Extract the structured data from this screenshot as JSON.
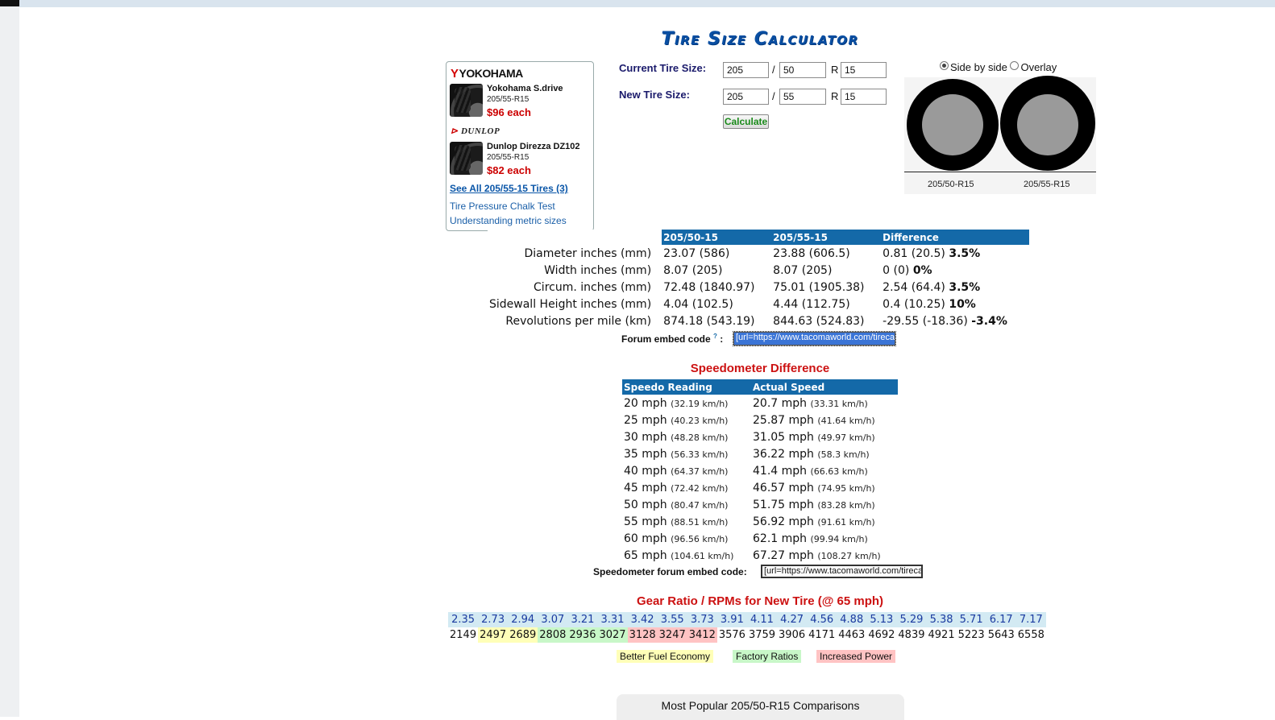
{
  "page": {
    "title": "Tire Size Calculator"
  },
  "ad": {
    "yokohama_brand": "YOKOHAMA",
    "dunlop_brand": "DUNLOP",
    "products": [
      {
        "name": "Yokohama S.drive",
        "size": "205/55-R15",
        "price": "$96 each"
      },
      {
        "name": "Dunlop Direzza DZ102",
        "size": "205/55-R15",
        "price": "$82 each"
      }
    ],
    "see_all": "See All 205/55-15 Tires (3)",
    "links": [
      "Tire Pressure Chalk Test",
      "Understanding metric sizes"
    ]
  },
  "form": {
    "current_label": "Current Tire Size:",
    "new_label": "New Tire Size:",
    "current": {
      "width": "205",
      "aspect": "50",
      "rim": "15"
    },
    "new": {
      "width": "205",
      "aspect": "55",
      "rim": "15"
    },
    "slash": "/",
    "r": "R",
    "calculate_label": "Calculate"
  },
  "visual": {
    "options": [
      "Side by side",
      "Overlay"
    ],
    "selected": "Side by side",
    "tire1_label": "205/50-R15",
    "tire2_label": "205/55-R15"
  },
  "stats": {
    "headers": [
      "205/50-15",
      "205/55-15",
      "Difference"
    ],
    "rows": [
      {
        "label": "Diameter inches (mm)",
        "a": "23.07 (586)",
        "b": "23.88 (606.5)",
        "diff": "0.81 (20.5)",
        "pct": "3.5%"
      },
      {
        "label": "Width inches (mm)",
        "a": "8.07 (205)",
        "b": "8.07 (205)",
        "diff": "0 (0)",
        "pct": "0%"
      },
      {
        "label": "Circum. inches (mm)",
        "a": "72.48 (1840.97)",
        "b": "75.01 (1905.38)",
        "diff": "2.54 (64.4)",
        "pct": "3.5%"
      },
      {
        "label": "Sidewall Height inches (mm)",
        "a": "4.04 (102.5)",
        "b": "4.44 (112.75)",
        "diff": "0.4 (10.25)",
        "pct": "10%"
      },
      {
        "label": "Revolutions per mile (km)",
        "a": "874.18 (543.19)",
        "b": "844.63 (524.83)",
        "diff": "-29.55 (-18.36)",
        "pct": "-3.4%"
      }
    ],
    "embed_label": "Forum embed code",
    "embed_help": "?",
    "embed_colon": ":",
    "embed_value": "[url=https://www.tacomaworld.com/tirecalc"
  },
  "speedo": {
    "title": "Speedometer Difference",
    "headers": [
      "Speedo Reading",
      "Actual Speed"
    ],
    "rows": [
      {
        "reading": "20 mph",
        "reading_kmh": "(32.19 km/h)",
        "actual": "20.7 mph",
        "actual_kmh": "(33.31 km/h)"
      },
      {
        "reading": "25 mph",
        "reading_kmh": "(40.23 km/h)",
        "actual": "25.87 mph",
        "actual_kmh": "(41.64 km/h)"
      },
      {
        "reading": "30 mph",
        "reading_kmh": "(48.28 km/h)",
        "actual": "31.05 mph",
        "actual_kmh": "(49.97 km/h)"
      },
      {
        "reading": "35 mph",
        "reading_kmh": "(56.33 km/h)",
        "actual": "36.22 mph",
        "actual_kmh": "(58.3 km/h)"
      },
      {
        "reading": "40 mph",
        "reading_kmh": "(64.37 km/h)",
        "actual": "41.4 mph",
        "actual_kmh": "(66.63 km/h)"
      },
      {
        "reading": "45 mph",
        "reading_kmh": "(72.42 km/h)",
        "actual": "46.57 mph",
        "actual_kmh": "(74.95 km/h)"
      },
      {
        "reading": "50 mph",
        "reading_kmh": "(80.47 km/h)",
        "actual": "51.75 mph",
        "actual_kmh": "(83.28 km/h)"
      },
      {
        "reading": "55 mph",
        "reading_kmh": "(88.51 km/h)",
        "actual": "56.92 mph",
        "actual_kmh": "(91.61 km/h)"
      },
      {
        "reading": "60 mph",
        "reading_kmh": "(96.56 km/h)",
        "actual": "62.1 mph",
        "actual_kmh": "(99.94 km/h)"
      },
      {
        "reading": "65 mph",
        "reading_kmh": "(104.61 km/h)",
        "actual": "67.27 mph",
        "actual_kmh": "(108.27 km/h)"
      }
    ],
    "embed_label": "Speedometer forum embed code:",
    "embed_value": "[url=https://www.tacomaworld.com/tirecalc"
  },
  "gear": {
    "title": "Gear Ratio / RPMs for New Tire (@ 65 mph)",
    "ratios": [
      "2.35",
      "2.73",
      "2.94",
      "3.07",
      "3.21",
      "3.31",
      "3.42",
      "3.55",
      "3.73",
      "3.91",
      "4.11",
      "4.27",
      "4.56",
      "4.88",
      "5.13",
      "5.29",
      "5.38",
      "5.71",
      "6.17",
      "7.17"
    ],
    "rpms": [
      "2149",
      "2497",
      "2689",
      "2808",
      "2936",
      "3027",
      "3128",
      "3247",
      "3412",
      "3576",
      "3759",
      "3906",
      "4171",
      "4463",
      "4692",
      "4839",
      "4921",
      "5223",
      "5643",
      "6558"
    ],
    "classes": [
      "",
      "eco",
      "eco",
      "fac",
      "fac",
      "fac",
      "pow",
      "pow",
      "pow",
      "",
      "",
      "",
      "",
      "",
      "",
      "",
      "",
      "",
      "",
      ""
    ],
    "legend": {
      "eco": "Better Fuel Economy",
      "fac": "Factory Ratios",
      "pow": "Increased Power"
    },
    "colors": {
      "eco": "#ffffb8",
      "fac": "#c8f7c8",
      "pow": "#ffc3c3",
      "ratio_bg": "#d3eaf3"
    }
  },
  "popular": {
    "title": "Most Popular 205/50-R15 Comparisons"
  },
  "colors": {
    "header_blue": "#1469a8",
    "title_blue": "#0a4fa3",
    "section_red": "#cc1111",
    "price_red": "#cc0000",
    "button_green": "#1a8a1a"
  }
}
